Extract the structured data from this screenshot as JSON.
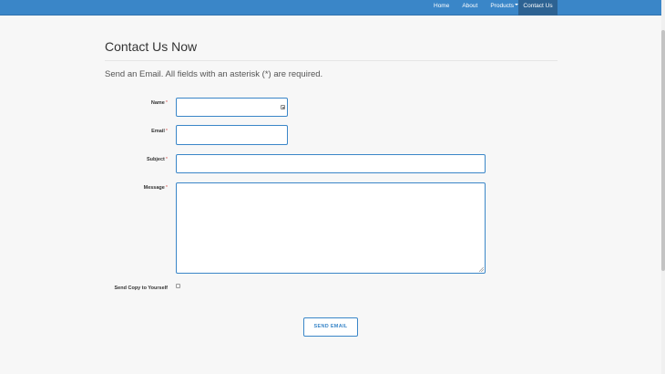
{
  "nav": {
    "items": [
      {
        "label": "Home"
      },
      {
        "label": "About"
      },
      {
        "label": "Products"
      }
    ],
    "active_label": "Contact Us"
  },
  "page": {
    "title": "Contact Us Now",
    "lead": "Send an Email. All fields with an asterisk (*) are required."
  },
  "form": {
    "name_label": "Name",
    "email_label": "Email",
    "subject_label": "Subject",
    "message_label": "Message",
    "required_mark": "*",
    "copy_label": "Send Copy to Yourself",
    "name_value": "",
    "email_value": "",
    "subject_value": "",
    "message_value": "",
    "copy_checked": false,
    "submit_label": "SEND EMAIL"
  },
  "colors": {
    "navbar": "#3a86c8",
    "nav_active": "#2d6292",
    "accent": "#3a86c8",
    "required": "#d9534f"
  },
  "icons": {
    "name_field": "contact-card-icon",
    "products_caret": "chevron-down-icon"
  }
}
